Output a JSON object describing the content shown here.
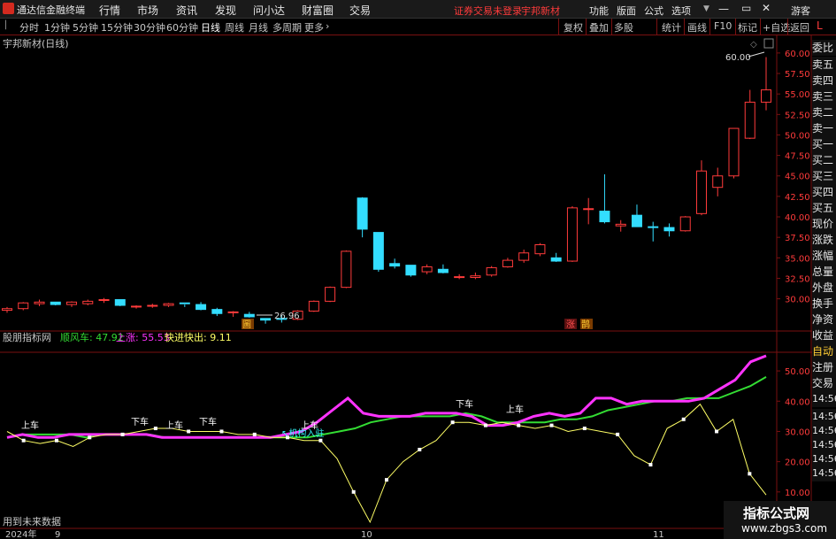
{
  "titlebar": {
    "app_name": "通达信金融终端",
    "menus": [
      "行情",
      "市场",
      "资讯",
      "发现",
      "问小达",
      "财富圈",
      "交易"
    ],
    "login_status": "证券交易未登录",
    "stock_name": "宇邦新材",
    "right_menus": [
      "功能",
      "版面",
      "公式",
      "选项"
    ],
    "guest": "游客"
  },
  "periods": [
    "分时",
    "1分钟",
    "5分钟",
    "15分钟",
    "30分钟",
    "60分钟",
    "日线",
    "周线",
    "月线",
    "多周期",
    "更多"
  ],
  "active_period": "日线",
  "toolbar": [
    "复权",
    "叠加",
    "多股",
    "统计",
    "画线",
    "F10",
    "标记",
    "+自选",
    "返回"
  ],
  "main_chart": {
    "title": "宇邦新材(日线)",
    "y_labels": [
      "60.00",
      "57.50",
      "55.00",
      "52.50",
      "50.00",
      "47.50",
      "45.00",
      "42.50",
      "40.00",
      "37.50",
      "35.00",
      "32.50",
      "30.00"
    ],
    "max_label": "60.00",
    "min_label": "26.96",
    "event_marks": [
      "圖",
      "涨",
      "鹊"
    ]
  },
  "indicator": {
    "name": "股朋指标网",
    "labels": [
      {
        "text": "顺风车: 47.92",
        "color": "#33dd33"
      },
      {
        "text": "上涨: 55.53",
        "color": "#ff33ff"
      },
      {
        "text": "快进快出: 9.11",
        "color": "#ffff66"
      }
    ],
    "y_labels": [
      "50.00",
      "40.00",
      "30.00",
      "20.00",
      "10.00"
    ],
    "annotations": [
      "上车",
      "下车",
      "上车",
      "下车",
      "上车",
      "下车",
      "上车",
      "↖机构入驻"
    ],
    "footer": "用到未来数据"
  },
  "right_panel": [
    "L",
    "委比",
    "卖五",
    "卖四",
    "卖三",
    "卖二",
    "卖一",
    "买一",
    "买二",
    "买三",
    "买四",
    "买五",
    "现价",
    "涨跌",
    "涨幅",
    "总量",
    "外盘",
    "换手",
    "净资",
    "收益",
    "自动",
    "注册",
    "交易",
    "14:56",
    "14:56",
    "14:56",
    "14:56",
    "14:56",
    "14:56"
  ],
  "x_axis": [
    "2024年",
    "9",
    "10",
    "11"
  ],
  "watermark": {
    "title": "指标公式网",
    "url": "www.zbgs3.com"
  },
  "chart_data": {
    "type": "candlestick",
    "title": "宇邦新材(日线)",
    "ylim": [
      26.5,
      61.5
    ],
    "candles": [
      [
        28.6,
        29.0,
        28.3,
        28.8
      ],
      [
        28.8,
        29.6,
        28.6,
        29.5
      ],
      [
        29.4,
        29.9,
        29.1,
        29.6
      ],
      [
        29.6,
        29.5,
        29.2,
        29.3
      ],
      [
        29.3,
        29.7,
        29.0,
        29.6
      ],
      [
        29.4,
        29.9,
        29.2,
        29.7
      ],
      [
        29.8,
        30.1,
        29.5,
        29.9
      ],
      [
        29.9,
        29.3,
        29.1,
        29.2
      ],
      [
        29.0,
        29.2,
        28.8,
        29.1
      ],
      [
        29.1,
        29.4,
        28.9,
        29.2
      ],
      [
        29.2,
        29.5,
        29.0,
        29.4
      ],
      [
        29.5,
        29.3,
        29.0,
        29.4
      ],
      [
        29.3,
        29.6,
        28.6,
        28.7
      ],
      [
        28.7,
        28.9,
        27.9,
        28.2
      ],
      [
        28.3,
        28.5,
        27.8,
        28.4
      ],
      [
        28.1,
        28.4,
        27.7,
        27.8
      ],
      [
        27.6,
        27.6,
        26.96,
        27.4
      ],
      [
        27.6,
        28.0,
        27.1,
        27.5
      ],
      [
        27.5,
        28.6,
        27.4,
        28.5
      ],
      [
        28.5,
        29.8,
        28.4,
        29.7
      ],
      [
        29.7,
        31.5,
        29.6,
        31.4
      ],
      [
        31.4,
        35.9,
        31.3,
        35.8
      ],
      [
        42.3,
        42.4,
        37.5,
        38.5
      ],
      [
        38.1,
        38.1,
        33.3,
        33.6
      ],
      [
        34.3,
        34.9,
        33.7,
        34.0
      ],
      [
        34.1,
        34.1,
        32.7,
        32.9
      ],
      [
        33.3,
        34.2,
        33.0,
        33.9
      ],
      [
        33.6,
        34.2,
        33.1,
        33.2
      ],
      [
        32.7,
        33.0,
        32.4,
        32.7
      ],
      [
        32.6,
        33.2,
        32.4,
        32.8
      ],
      [
        32.9,
        34.0,
        32.7,
        33.8
      ],
      [
        33.9,
        35.0,
        33.8,
        34.7
      ],
      [
        34.7,
        36.0,
        34.4,
        35.6
      ],
      [
        35.5,
        36.8,
        35.2,
        36.6
      ],
      [
        35.0,
        35.6,
        34.5,
        34.6
      ],
      [
        34.6,
        41.3,
        34.5,
        41.1
      ],
      [
        41.0,
        42.3,
        39.1,
        41.0
      ],
      [
        40.7,
        45.2,
        39.2,
        39.4
      ],
      [
        38.9,
        39.6,
        38.2,
        39.1
      ],
      [
        40.2,
        41.5,
        38.8,
        38.8
      ],
      [
        38.8,
        39.4,
        37.0,
        38.7
      ],
      [
        38.7,
        39.2,
        37.6,
        38.3
      ],
      [
        38.3,
        40.1,
        38.2,
        40.0
      ],
      [
        40.4,
        46.9,
        40.2,
        45.6
      ],
      [
        43.6,
        46.0,
        42.5,
        45.0
      ],
      [
        45.0,
        50.8,
        44.7,
        50.8
      ],
      [
        49.6,
        55.5,
        49.5,
        54.0
      ],
      [
        54.0,
        59.5,
        53.0,
        55.5
      ]
    ],
    "series": [
      {
        "name": "顺风车",
        "color": "#33dd33",
        "values": [
          28,
          29,
          29,
          29,
          29,
          28,
          29,
          29,
          29,
          29,
          28,
          28,
          28,
          28,
          28,
          28,
          28,
          28,
          28,
          28,
          29,
          30,
          31,
          33,
          34,
          35,
          35,
          35,
          35,
          36,
          35,
          33,
          33,
          33,
          33,
          34,
          34,
          35,
          37,
          38,
          39,
          40,
          40,
          41,
          41,
          41,
          43,
          45,
          48
        ]
      },
      {
        "name": "上涨",
        "color": "#ff33ff",
        "values": [
          28,
          29,
          28,
          28,
          29,
          29,
          29,
          29,
          29,
          29,
          28,
          28,
          28,
          28,
          28,
          28,
          28,
          28,
          29,
          30,
          33,
          37,
          41,
          36,
          35,
          35,
          35,
          36,
          36,
          36,
          35,
          32,
          32,
          33,
          35,
          36,
          35,
          36,
          41,
          41,
          39,
          40,
          40,
          40,
          40,
          41,
          44,
          47,
          53,
          55
        ]
      },
      {
        "name": "快进快出",
        "color": "#ffff66",
        "values": [
          30,
          27,
          26,
          27,
          25,
          28,
          29,
          29,
          30,
          31,
          31,
          30,
          30,
          30,
          29,
          29,
          28,
          28,
          27,
          27,
          21,
          10,
          0,
          14,
          20,
          24,
          27,
          33,
          33,
          32,
          33,
          32,
          31,
          32,
          30,
          31,
          30,
          29,
          22,
          19,
          31,
          34,
          39,
          30,
          34,
          16,
          9
        ]
      }
    ],
    "indicator_ylim": [
      0,
      55
    ]
  }
}
